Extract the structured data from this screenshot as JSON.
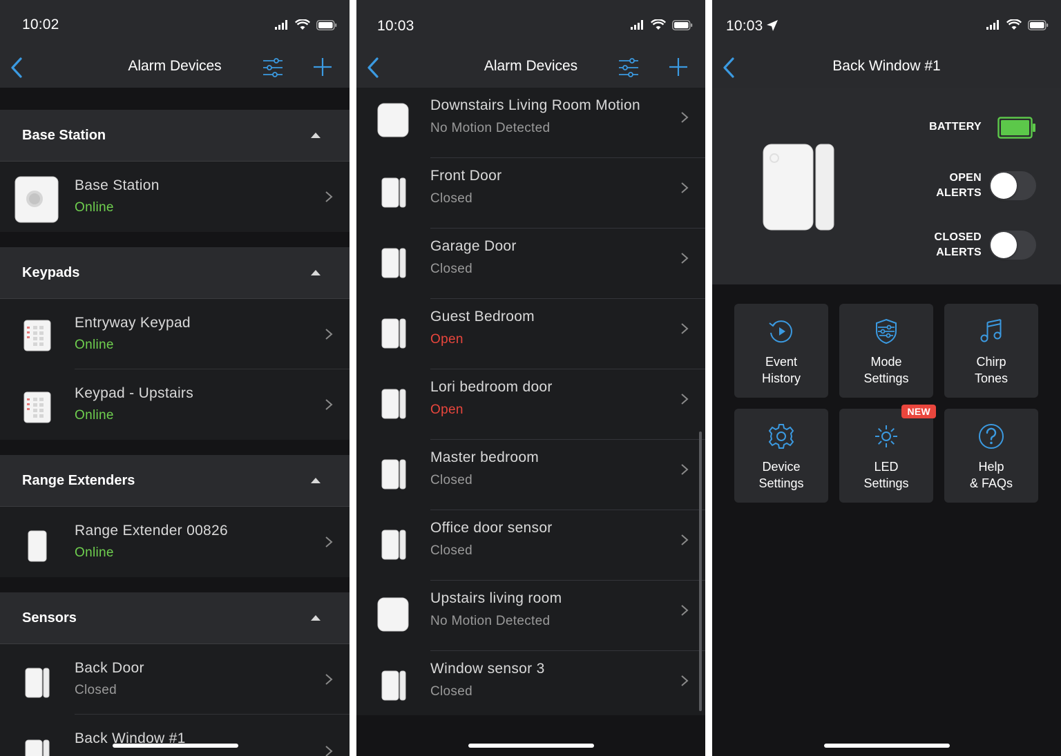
{
  "panel1": {
    "time": "10:02",
    "title": "Alarm Devices",
    "sections": [
      {
        "header": "Base Station",
        "items": [
          {
            "name": "Base Station",
            "status": "Online",
            "status_color": "#6fcf4f"
          }
        ]
      },
      {
        "header": "Keypads",
        "items": [
          {
            "name": "Entryway Keypad",
            "status": "Online",
            "status_color": "#6fcf4f"
          },
          {
            "name": "Keypad - Upstairs",
            "status": "Online",
            "status_color": "#6fcf4f"
          }
        ]
      },
      {
        "header": "Range Extenders",
        "items": [
          {
            "name": "Range Extender 00826",
            "status": "Online",
            "status_color": "#6fcf4f"
          }
        ]
      },
      {
        "header": "Sensors",
        "items": [
          {
            "name": "Back Door",
            "status": "Closed",
            "status_color": "#9a9a9a"
          },
          {
            "name": "Back Window #1",
            "status": "",
            "status_color": "#9a9a9a"
          }
        ]
      }
    ]
  },
  "panel2": {
    "time": "10:03",
    "title": "Alarm Devices",
    "items": [
      {
        "name": "Downstairs Living Room Motion",
        "status": "No Motion Detected",
        "status_color": "#9a9a9a",
        "icon": "motion-sensor-icon"
      },
      {
        "name": "Front Door",
        "status": "Closed",
        "status_color": "#9a9a9a",
        "icon": "contact-sensor-icon"
      },
      {
        "name": "Garage Door",
        "status": "Closed",
        "status_color": "#9a9a9a",
        "icon": "contact-sensor-icon"
      },
      {
        "name": "Guest Bedroom",
        "status": "Open",
        "status_color": "#e9463d",
        "icon": "contact-sensor-icon"
      },
      {
        "name": "Lori bedroom door",
        "status": "Open",
        "status_color": "#e9463d",
        "icon": "contact-sensor-icon"
      },
      {
        "name": "Master bedroom",
        "status": "Closed",
        "status_color": "#9a9a9a",
        "icon": "contact-sensor-icon"
      },
      {
        "name": "Office door sensor",
        "status": "Closed",
        "status_color": "#9a9a9a",
        "icon": "contact-sensor-icon"
      },
      {
        "name": "Upstairs living room",
        "status": "No Motion Detected",
        "status_color": "#9a9a9a",
        "icon": "motion-sensor-icon"
      },
      {
        "name": "Window sensor 3",
        "status": "Closed",
        "status_color": "#9a9a9a",
        "icon": "contact-sensor-icon"
      }
    ]
  },
  "panel3": {
    "time": "10:03",
    "title": "Back Window #1",
    "battery_label": "BATTERY",
    "battery_color": "#5cc84a",
    "open_alerts_label": [
      "OPEN",
      "ALERTS"
    ],
    "closed_alerts_label": [
      "CLOSED",
      "ALERTS"
    ],
    "open_alerts_on": false,
    "closed_alerts_on": false,
    "tiles": [
      {
        "line1": "Event",
        "line2": "History",
        "icon": "history-icon"
      },
      {
        "line1": "Mode",
        "line2": "Settings",
        "icon": "shield-sliders-icon"
      },
      {
        "line1": "Chirp",
        "line2": "Tones",
        "icon": "music-note-icon"
      },
      {
        "line1": "Device",
        "line2": "Settings",
        "icon": "gear-icon"
      },
      {
        "line1": "LED",
        "line2": "Settings",
        "icon": "sun-icon",
        "badge": "NEW"
      },
      {
        "line1": "Help",
        "line2": "& FAQs",
        "icon": "question-icon"
      }
    ]
  },
  "accent_color": "#3b9ae1"
}
